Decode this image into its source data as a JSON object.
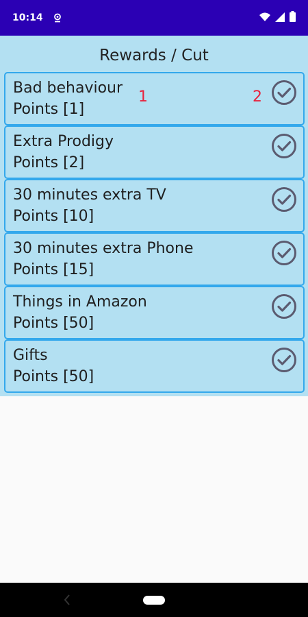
{
  "status_bar": {
    "time": "10:14",
    "background": "#2b00b4",
    "icons": [
      "location-icon",
      "wifi-icon",
      "signal-icon",
      "battery-icon"
    ]
  },
  "page": {
    "title": "Rewards / Cut"
  },
  "rewards": [
    {
      "title": "Bad behaviour",
      "points": "Points [1]"
    },
    {
      "title": "Extra Prodigy",
      "points": "Points [2]"
    },
    {
      "title": "30 minutes extra TV",
      "points": "Points [10]"
    },
    {
      "title": "30 minutes extra Phone",
      "points": "Points [15]"
    },
    {
      "title": "Things in Amazon",
      "points": "Points [50]"
    },
    {
      "title": "Gifts",
      "points": "Points [50]"
    }
  ],
  "annotations": {
    "marker_1": "1",
    "marker_2": "2"
  },
  "colors": {
    "card_background": "#b3e0f2",
    "card_border": "#33a8ec",
    "check_icon": "#5b5b70",
    "annotation": "#e8213c"
  },
  "nav_bar": {
    "icons": [
      "back-icon",
      "home-pill"
    ]
  }
}
